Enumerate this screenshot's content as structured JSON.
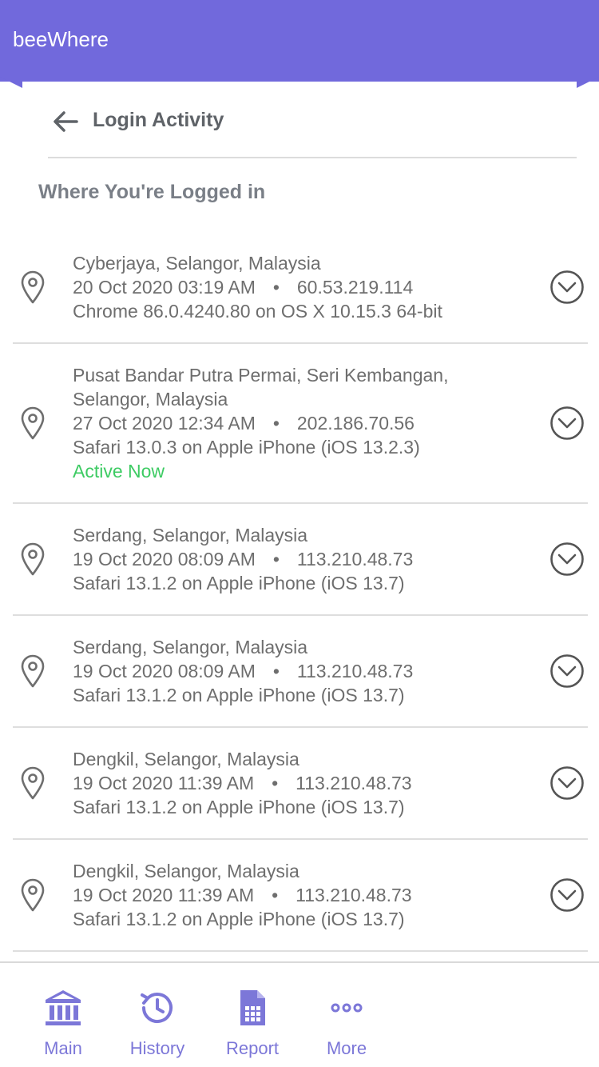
{
  "app": {
    "title": "beeWhere",
    "accent": "#7169dc"
  },
  "page": {
    "title": "Login Activity",
    "back_icon": "arrow-left-icon"
  },
  "section": {
    "title": "Where You're Logged in"
  },
  "sessions": [
    {
      "location_lines": [
        "Cyberjaya, Selangor, Malaysia"
      ],
      "datetime": "20 Oct 2020 03:19 AM",
      "separator": "•",
      "ip": "60.53.219.114",
      "device": "Chrome 86.0.4240.80 on OS X 10.15.3 64-bit",
      "status": ""
    },
    {
      "location_lines": [
        "Pusat Bandar Putra Permai, Seri Kembangan,",
        "Selangor, Malaysia"
      ],
      "datetime": "27 Oct 2020 12:34 AM",
      "separator": "•",
      "ip": "202.186.70.56",
      "device": "Safari 13.0.3 on Apple iPhone (iOS 13.2.3)",
      "status": "Active Now"
    },
    {
      "location_lines": [
        "Serdang, Selangor, Malaysia"
      ],
      "datetime": "19 Oct 2020 08:09 AM",
      "separator": "•",
      "ip": "113.210.48.73",
      "device": "Safari 13.1.2 on Apple iPhone (iOS 13.7)",
      "status": ""
    },
    {
      "location_lines": [
        "Serdang, Selangor, Malaysia"
      ],
      "datetime": "19 Oct 2020 08:09 AM",
      "separator": "•",
      "ip": "113.210.48.73",
      "device": "Safari 13.1.2 on Apple iPhone (iOS 13.7)",
      "status": ""
    },
    {
      "location_lines": [
        "Dengkil, Selangor, Malaysia"
      ],
      "datetime": "19 Oct 2020 11:39 AM",
      "separator": "•",
      "ip": "113.210.48.73",
      "device": "Safari 13.1.2 on Apple iPhone (iOS 13.7)",
      "status": ""
    },
    {
      "location_lines": [
        "Dengkil, Selangor, Malaysia"
      ],
      "datetime": "19 Oct 2020 11:39 AM",
      "separator": "•",
      "ip": "113.210.48.73",
      "device": "Safari 13.1.2 on Apple iPhone (iOS 13.7)",
      "status": ""
    }
  ],
  "status_color": "#3dcb63",
  "tabs": [
    {
      "label": "Main",
      "icon": "bank-icon"
    },
    {
      "label": "History",
      "icon": "history-icon"
    },
    {
      "label": "Report",
      "icon": "report-icon"
    },
    {
      "label": "More",
      "icon": "more-icon"
    }
  ]
}
